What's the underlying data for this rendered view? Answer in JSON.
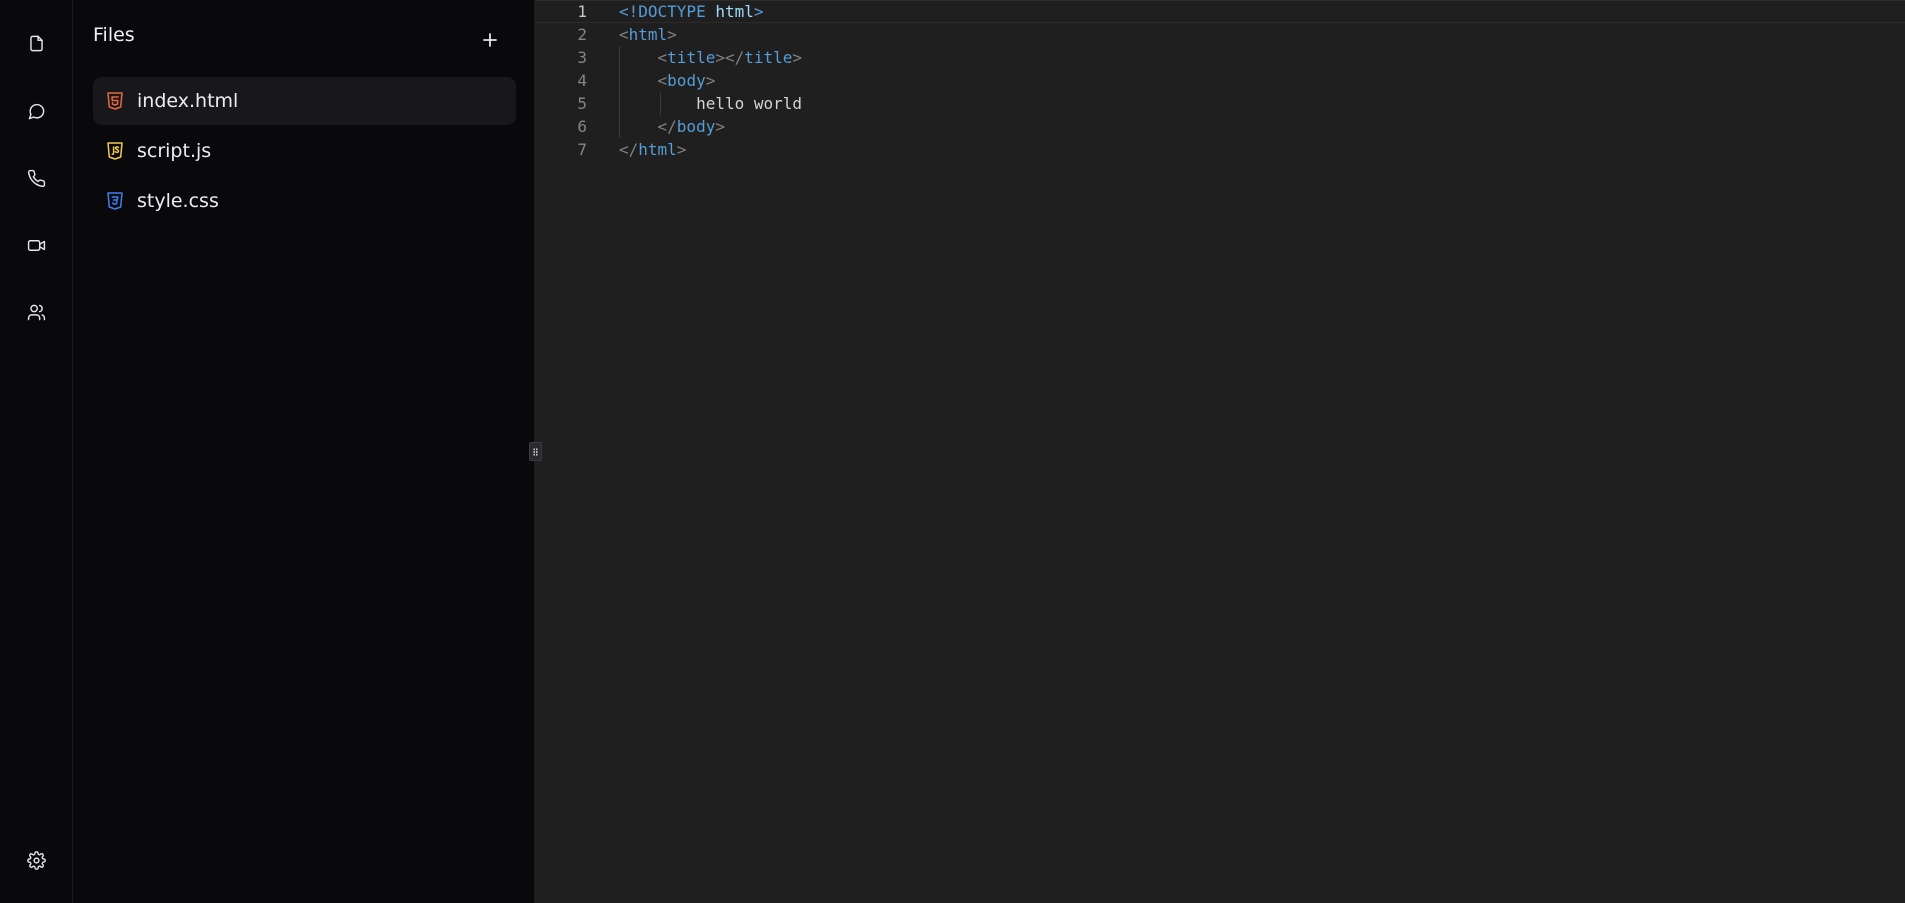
{
  "rail": {
    "items": [
      {
        "name": "files",
        "icon": "file-icon"
      },
      {
        "name": "chat",
        "icon": "chat-bubble-icon"
      },
      {
        "name": "call",
        "icon": "phone-icon"
      },
      {
        "name": "video",
        "icon": "video-icon"
      },
      {
        "name": "people",
        "icon": "users-icon"
      }
    ],
    "settings_icon": "gear-icon"
  },
  "files_panel": {
    "title": "Files",
    "add_icon": "plus-icon",
    "files": [
      {
        "name": "index.html",
        "type": "html",
        "active": true,
        "color": "#e8683c"
      },
      {
        "name": "script.js",
        "type": "js",
        "active": false,
        "color": "#f2c94c"
      },
      {
        "name": "style.css",
        "type": "css",
        "active": false,
        "color": "#3f7ef0"
      }
    ]
  },
  "editor": {
    "active_line": 1,
    "lines": [
      {
        "num": "1",
        "indent": "",
        "tokens": [
          {
            "t": "<!DOCTYPE",
            "c": "tag"
          },
          {
            "t": " html",
            "c": "attr"
          },
          {
            "t": ">",
            "c": "tag"
          }
        ]
      },
      {
        "num": "2",
        "indent": "",
        "tokens": [
          {
            "t": "<",
            "c": "punct"
          },
          {
            "t": "html",
            "c": "tag"
          },
          {
            "t": ">",
            "c": "punct"
          }
        ]
      },
      {
        "num": "3",
        "indent": "    ",
        "tokens": [
          {
            "t": "<",
            "c": "punct"
          },
          {
            "t": "title",
            "c": "tag"
          },
          {
            "t": "></",
            "c": "punct"
          },
          {
            "t": "title",
            "c": "tag"
          },
          {
            "t": ">",
            "c": "punct"
          }
        ]
      },
      {
        "num": "4",
        "indent": "    ",
        "tokens": [
          {
            "t": "<",
            "c": "punct"
          },
          {
            "t": "body",
            "c": "tag"
          },
          {
            "t": ">",
            "c": "punct"
          }
        ]
      },
      {
        "num": "5",
        "indent": "        ",
        "tokens": [
          {
            "t": "hello world",
            "c": "text"
          }
        ]
      },
      {
        "num": "6",
        "indent": "    ",
        "tokens": [
          {
            "t": "</",
            "c": "punct"
          },
          {
            "t": "body",
            "c": "tag"
          },
          {
            "t": ">",
            "c": "punct"
          }
        ]
      },
      {
        "num": "7",
        "indent": "",
        "tokens": [
          {
            "t": "</",
            "c": "punct"
          },
          {
            "t": "html",
            "c": "tag"
          },
          {
            "t": ">",
            "c": "punct"
          }
        ]
      }
    ]
  }
}
